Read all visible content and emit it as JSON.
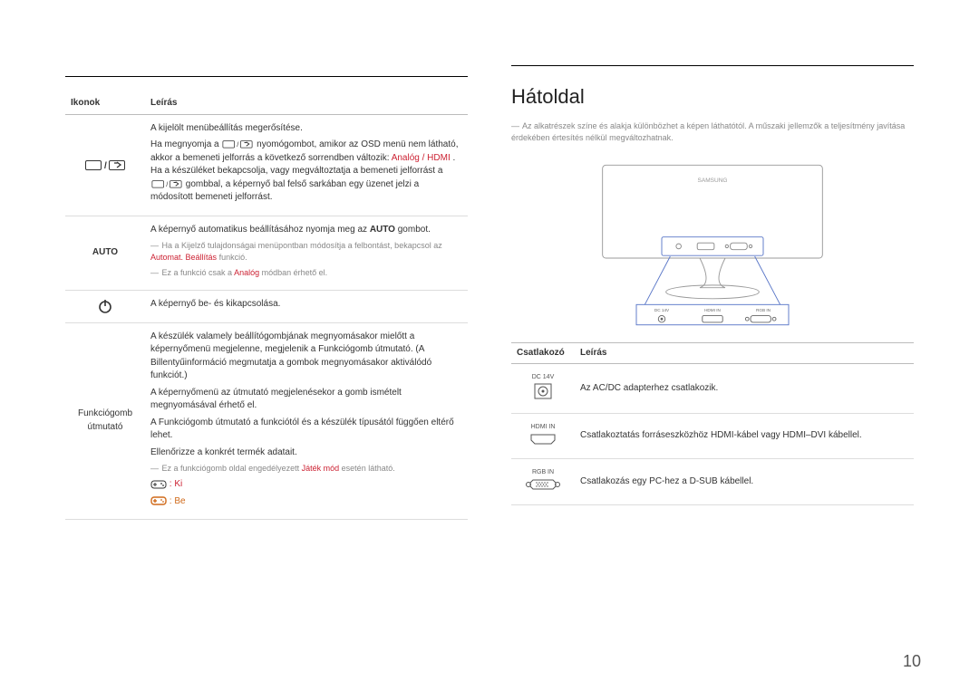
{
  "left": {
    "headers": {
      "col1": "Ikonok",
      "col2": "Leírás"
    },
    "row1": {
      "p1a": "A kijelölt menübeállítás megerősítése.",
      "p1b_1": "Ha megnyomja a ",
      "p1b_2": " nyomógombot, amikor az OSD menü nem látható, akkor a bemeneti jelforrás a következő sorrendben változik: ",
      "p1b_source": "Analóg / HDMI",
      "p1b_3": ". Ha a készüléket bekapcsolja, vagy megváltoztatja a bemeneti jelforrást a ",
      "p1b_4": " gombbal, a képernyő bal felső sarkában egy üzenet jelzi a módosított bemeneti jelforrást."
    },
    "row2": {
      "icon_label": "AUTO",
      "p1_1": "A képernyő automatikus beállításához nyomja meg az ",
      "p1_bold": "AUTO",
      "p1_2": " gombot.",
      "note1_1": "Ha a Kijelző tulajdonságai menüpontban módosítja a felbontást, bekapcsol az ",
      "note1_red": "Automat. Beállítás",
      "note1_2": " funkció.",
      "note2_1": "Ez a funkció csak a ",
      "note2_red": "Analóg",
      "note2_2": " módban érhető el."
    },
    "row3": {
      "p": "A képernyő be- és kikapcsolása."
    },
    "row4": {
      "label": "Funkciógomb útmutató",
      "p1": "A készülék valamely beállítógombjának megnyomásakor mielőtt a képernyőmenü megjelenne, megjelenik a Funkciógomb útmutató. (A Billentyűinformáció megmutatja a gombok megnyomásakor aktiválódó funkciót.)",
      "p2": "A képernyőmenü az útmutató megjelenésekor a gomb ismételt megnyomásával érhető el.",
      "p3": "A Funkciógomb útmutató a funkciótól és a készülék típusától függően eltérő lehet.",
      "p4": "Ellenőrizze a konkrét termék adatait.",
      "note_1": "Ez a funkciógomb oldal engedélyezett ",
      "note_red": "Játék mód",
      "note_2": " esetén látható.",
      "opt_off": ": Ki",
      "opt_on": ": Be"
    }
  },
  "right": {
    "heading": "Hátoldal",
    "intro": "Az alkatrészek színe és alakja különbözhet a képen láthatótól. A műszaki jellemzők a teljesítmény javítása érdekében értesítés nélkül megváltozhatnak.",
    "rear_labels": {
      "brand": "SAMSUNG",
      "dc": "DC 14V",
      "hdmi": "HDMI IN",
      "rgb": "RGB IN"
    },
    "headers": {
      "col1": "Csatlakozó",
      "col2": "Leírás"
    },
    "ports": {
      "dc": {
        "label": "DC 14V",
        "desc": "Az AC/DC adapterhez csatlakozik."
      },
      "hdmi": {
        "label": "HDMI IN",
        "desc": "Csatlakoztatás forráseszközhöz HDMI-kábel vagy HDMI–DVI kábellel."
      },
      "rgb": {
        "label": "RGB IN",
        "desc": "Csatlakozás egy PC-hez a D-SUB kábellel."
      }
    }
  },
  "page_number": "10"
}
